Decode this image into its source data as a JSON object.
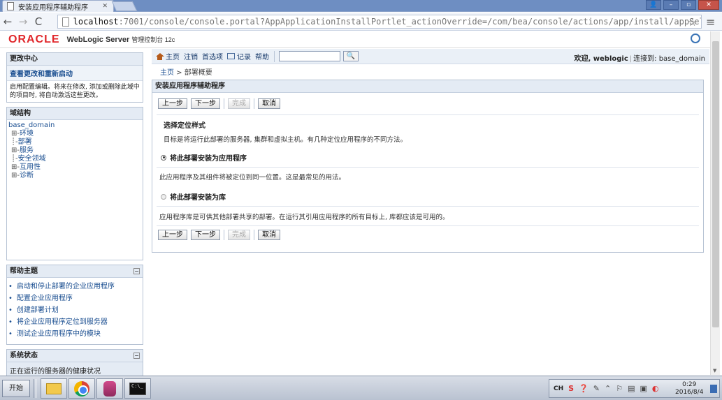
{
  "browser": {
    "tab_title": "安装应用程序辅助程序",
    "url_host": "localhost",
    "url_rest": ":7001/console/console.portal?AppApplicationInstallPortlet_actionOverride=/com/bea/console/actions/app/install/appSelected"
  },
  "header": {
    "logo": "ORACLE",
    "product": "WebLogic Server",
    "product_suffix": "管理控制台 12c"
  },
  "change_center": {
    "title": "更改中心",
    "link": "查看更改和重新启动",
    "text": "启用配置编辑。将来在修改, 添加或删除此域中的项目时, 将自动激活这些更改。"
  },
  "domain_structure": {
    "title": "域结构",
    "root": "base_domain",
    "nodes": [
      {
        "prefix": "⊞-",
        "label": "环境"
      },
      {
        "prefix": "┊-",
        "label": "部署"
      },
      {
        "prefix": "⊞-",
        "label": "服务"
      },
      {
        "prefix": "┊-",
        "label": "安全领域"
      },
      {
        "prefix": "⊞-",
        "label": "互用性"
      },
      {
        "prefix": "⊞-",
        "label": "诊断"
      }
    ]
  },
  "help": {
    "title": "帮助主题",
    "items": [
      "启动和停止部署的企业应用程序",
      "配置企业应用程序",
      "创建部署计划",
      "将企业应用程序定位到服务器",
      "测试企业应用程序中的模块"
    ]
  },
  "system_status": {
    "title": "系统状态",
    "text": "正在运行的服务器的健康状况"
  },
  "toolbar": {
    "home": "主页",
    "logout": "注销",
    "prefs": "首选项",
    "record": "记录",
    "help": "帮助",
    "search_btn": "🔍",
    "welcome": "欢迎, weblogic",
    "connected": "连接到: base_domain"
  },
  "breadcrumb": {
    "home": "主页",
    "current": "部署概要"
  },
  "assistant": {
    "title": "安装应用程序辅助程序",
    "back": "上一步",
    "next": "下一步",
    "finish": "完成",
    "cancel": "取消",
    "section_title": "选择定位样式",
    "section_desc": "目标是将运行此部署的服务器, 集群和虚拟主机。有几种定位应用程序的不同方法。",
    "opt1": "将此部署安装为应用程序",
    "opt1_desc": "此应用程序及其组件将被定位到同一位置。这是最常见的用法。",
    "opt2": "将此部署安装为库",
    "opt2_desc": "应用程序库是可供其他部署共享的部署。在运行其引用应用程序的所有目标上, 库都应该是可用的。"
  },
  "taskbar": {
    "start": "开始",
    "lang": "CH",
    "time": "0:29",
    "date": "2016/8/4"
  }
}
